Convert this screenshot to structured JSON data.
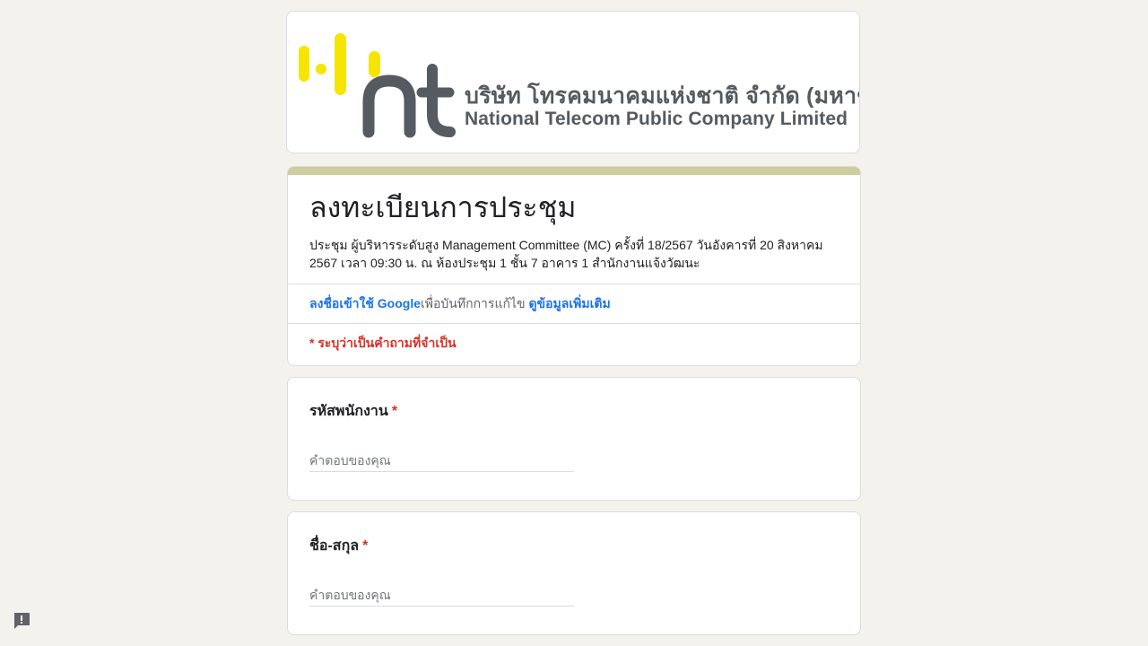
{
  "banner": {
    "company_thai": "บริษัท โทรคมนาคมแห่งชาติ จำกัด (มหาชน)",
    "company_en": "National Telecom Public Company Limited",
    "logo_letters": "nt",
    "logo_yellow": "#f5e500",
    "logo_gray": "#555b60"
  },
  "form": {
    "accent_color": "#cfcc9e",
    "title": "ลงทะเบียนการประชุม",
    "description": "ประชุม ผู้บริหารระดับสูง Management Committee (MC) ครั้งที่ 18/2567 วันอังคารที่ 20 สิงหาคม 2567 เวลา 09:30 น. ณ ห้องประชุม 1 ชั้น 7 อาคาร 1 สำนักงานแจ้งวัฒนะ",
    "signin_link": "ลงชื่อเข้าใช้ Google",
    "signin_text": "เพื่อบันทึกการแก้ไข",
    "learn_more_link": "ดูข้อมูลเพิ่มเติม",
    "required_note": "* ระบุว่าเป็นคำถามที่จำเป็น"
  },
  "questions": [
    {
      "label": "รหัสพนักงาน",
      "required_mark": "*",
      "placeholder": "คำตอบของคุณ",
      "value": ""
    },
    {
      "label": "ชื่อ-สกุล",
      "required_mark": "*",
      "placeholder": "คำตอบของคุณ",
      "value": ""
    }
  ],
  "feedback_icon": "report-feedback-icon"
}
